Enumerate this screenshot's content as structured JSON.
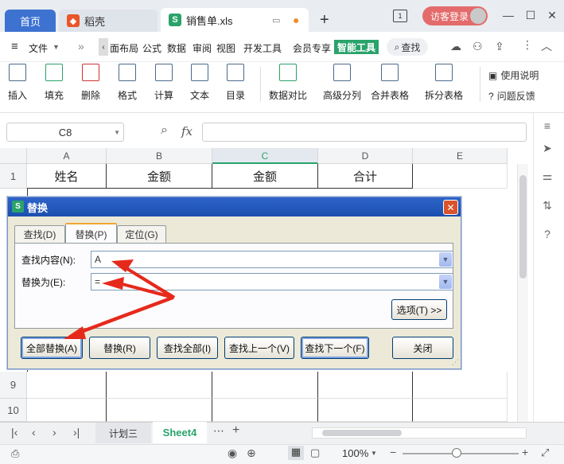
{
  "titlebar": {
    "tab_home": "首页",
    "tab_wps": "稻壳",
    "tab_file": "销售单.xls",
    "tab_file_icon": "S",
    "new_tab": "+",
    "visitor_login": "访客登录"
  },
  "menubar": {
    "file": "文件",
    "items": [
      "面布局",
      "公式",
      "数据",
      "审阅",
      "视图",
      "开发工具",
      "会员专享"
    ],
    "smart_tools": "智能工具",
    "search": "查找"
  },
  "ribbon": {
    "buttons": [
      "插入",
      "填充",
      "删除",
      "格式",
      "计算",
      "文本",
      "目录",
      "数据对比",
      "高级分列",
      "合并表格",
      "拆分表格"
    ],
    "help": "使用说明",
    "feedback": "问题反馈"
  },
  "formulabar": {
    "cell_ref": "C8",
    "fx": "fx"
  },
  "grid": {
    "columns": [
      "A",
      "B",
      "C",
      "D",
      "E"
    ],
    "rows": [
      "1",
      "9",
      "10"
    ],
    "header_cells": [
      "姓名",
      "金额",
      "金额",
      "合计"
    ]
  },
  "dialog": {
    "title": "替换",
    "logo": "S",
    "tabs": [
      "查找(D)",
      "替换(P)",
      "定位(G)"
    ],
    "find_label": "查找内容(N):",
    "find_value": "A",
    "replace_label": "替换为(E):",
    "replace_value": "=",
    "options_button": "选项(T) >>",
    "buttons": [
      "全部替换(A)",
      "替换(R)",
      "查找全部(I)",
      "查找上一个(V)",
      "查找下一个(F)",
      "关闭"
    ]
  },
  "sheetbar": {
    "tabs": [
      "计划三",
      "Sheet4"
    ],
    "more": "⋯",
    "add": "+"
  },
  "statusbar": {
    "zoom": "100%",
    "zoom_minus": "−",
    "zoom_plus": "+"
  },
  "colors": {
    "accent_blue": "#3d72d0",
    "smart_green": "#2aa36b",
    "arrow_red": "#e52a1c",
    "visitor_red": "#e36b6b"
  }
}
